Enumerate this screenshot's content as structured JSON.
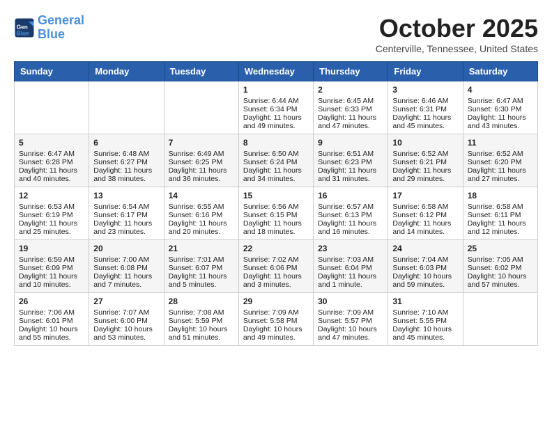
{
  "header": {
    "logo_line1": "General",
    "logo_line2": "Blue",
    "month_title": "October 2025",
    "location": "Centerville, Tennessee, United States"
  },
  "weekdays": [
    "Sunday",
    "Monday",
    "Tuesday",
    "Wednesday",
    "Thursday",
    "Friday",
    "Saturday"
  ],
  "weeks": [
    [
      {
        "day": "",
        "info": ""
      },
      {
        "day": "",
        "info": ""
      },
      {
        "day": "",
        "info": ""
      },
      {
        "day": "1",
        "info": "Sunrise: 6:44 AM\nSunset: 6:34 PM\nDaylight: 11 hours and 49 minutes."
      },
      {
        "day": "2",
        "info": "Sunrise: 6:45 AM\nSunset: 6:33 PM\nDaylight: 11 hours and 47 minutes."
      },
      {
        "day": "3",
        "info": "Sunrise: 6:46 AM\nSunset: 6:31 PM\nDaylight: 11 hours and 45 minutes."
      },
      {
        "day": "4",
        "info": "Sunrise: 6:47 AM\nSunset: 6:30 PM\nDaylight: 11 hours and 43 minutes."
      }
    ],
    [
      {
        "day": "5",
        "info": "Sunrise: 6:47 AM\nSunset: 6:28 PM\nDaylight: 11 hours and 40 minutes."
      },
      {
        "day": "6",
        "info": "Sunrise: 6:48 AM\nSunset: 6:27 PM\nDaylight: 11 hours and 38 minutes."
      },
      {
        "day": "7",
        "info": "Sunrise: 6:49 AM\nSunset: 6:25 PM\nDaylight: 11 hours and 36 minutes."
      },
      {
        "day": "8",
        "info": "Sunrise: 6:50 AM\nSunset: 6:24 PM\nDaylight: 11 hours and 34 minutes."
      },
      {
        "day": "9",
        "info": "Sunrise: 6:51 AM\nSunset: 6:23 PM\nDaylight: 11 hours and 31 minutes."
      },
      {
        "day": "10",
        "info": "Sunrise: 6:52 AM\nSunset: 6:21 PM\nDaylight: 11 hours and 29 minutes."
      },
      {
        "day": "11",
        "info": "Sunrise: 6:52 AM\nSunset: 6:20 PM\nDaylight: 11 hours and 27 minutes."
      }
    ],
    [
      {
        "day": "12",
        "info": "Sunrise: 6:53 AM\nSunset: 6:19 PM\nDaylight: 11 hours and 25 minutes."
      },
      {
        "day": "13",
        "info": "Sunrise: 6:54 AM\nSunset: 6:17 PM\nDaylight: 11 hours and 23 minutes."
      },
      {
        "day": "14",
        "info": "Sunrise: 6:55 AM\nSunset: 6:16 PM\nDaylight: 11 hours and 20 minutes."
      },
      {
        "day": "15",
        "info": "Sunrise: 6:56 AM\nSunset: 6:15 PM\nDaylight: 11 hours and 18 minutes."
      },
      {
        "day": "16",
        "info": "Sunrise: 6:57 AM\nSunset: 6:13 PM\nDaylight: 11 hours and 16 minutes."
      },
      {
        "day": "17",
        "info": "Sunrise: 6:58 AM\nSunset: 6:12 PM\nDaylight: 11 hours and 14 minutes."
      },
      {
        "day": "18",
        "info": "Sunrise: 6:58 AM\nSunset: 6:11 PM\nDaylight: 11 hours and 12 minutes."
      }
    ],
    [
      {
        "day": "19",
        "info": "Sunrise: 6:59 AM\nSunset: 6:09 PM\nDaylight: 11 hours and 10 minutes."
      },
      {
        "day": "20",
        "info": "Sunrise: 7:00 AM\nSunset: 6:08 PM\nDaylight: 11 hours and 7 minutes."
      },
      {
        "day": "21",
        "info": "Sunrise: 7:01 AM\nSunset: 6:07 PM\nDaylight: 11 hours and 5 minutes."
      },
      {
        "day": "22",
        "info": "Sunrise: 7:02 AM\nSunset: 6:06 PM\nDaylight: 11 hours and 3 minutes."
      },
      {
        "day": "23",
        "info": "Sunrise: 7:03 AM\nSunset: 6:04 PM\nDaylight: 11 hours and 1 minute."
      },
      {
        "day": "24",
        "info": "Sunrise: 7:04 AM\nSunset: 6:03 PM\nDaylight: 10 hours and 59 minutes."
      },
      {
        "day": "25",
        "info": "Sunrise: 7:05 AM\nSunset: 6:02 PM\nDaylight: 10 hours and 57 minutes."
      }
    ],
    [
      {
        "day": "26",
        "info": "Sunrise: 7:06 AM\nSunset: 6:01 PM\nDaylight: 10 hours and 55 minutes."
      },
      {
        "day": "27",
        "info": "Sunrise: 7:07 AM\nSunset: 6:00 PM\nDaylight: 10 hours and 53 minutes."
      },
      {
        "day": "28",
        "info": "Sunrise: 7:08 AM\nSunset: 5:59 PM\nDaylight: 10 hours and 51 minutes."
      },
      {
        "day": "29",
        "info": "Sunrise: 7:09 AM\nSunset: 5:58 PM\nDaylight: 10 hours and 49 minutes."
      },
      {
        "day": "30",
        "info": "Sunrise: 7:09 AM\nSunset: 5:57 PM\nDaylight: 10 hours and 47 minutes."
      },
      {
        "day": "31",
        "info": "Sunrise: 7:10 AM\nSunset: 5:55 PM\nDaylight: 10 hours and 45 minutes."
      },
      {
        "day": "",
        "info": ""
      }
    ]
  ]
}
